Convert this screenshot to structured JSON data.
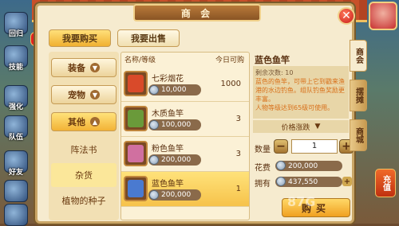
{
  "left_menu": [
    "回归",
    "技能",
    "强化",
    "队伍",
    "好友"
  ],
  "window": {
    "title": "商 会",
    "tabs": {
      "buy": "我要购买",
      "sell": "我要出售"
    }
  },
  "categories": {
    "equipment": "装备",
    "pet": "宠物",
    "other": "其他",
    "sub_items": [
      "阵法书",
      "杂货",
      "植物的种子"
    ]
  },
  "table": {
    "col_name": "名称/等级",
    "col_count": "今日可购",
    "rows": [
      {
        "name": "七彩烟花",
        "price": "10,000",
        "count": "1000",
        "color": "#d94a2a"
      },
      {
        "name": "木质鱼竿",
        "price": "100,000",
        "count": "3",
        "color": "#6a9a3a"
      },
      {
        "name": "粉色鱼竿",
        "price": "200,000",
        "count": "3",
        "color": "#d070a0"
      },
      {
        "name": "蓝色鱼竿",
        "price": "200,000",
        "count": "1",
        "color": "#4a7ad0"
      }
    ]
  },
  "detail": {
    "name": "蓝色鱼竿",
    "desc_line1": "剩余次数: 10",
    "desc_line2": "蓝色的鱼竿，可带上它到戳来渔港的水边钓鱼。组队钓鱼奖励更丰富。",
    "desc_line3": "人物等级达到65级可使用。",
    "price_trend": "价格涨跌",
    "qty_label": "数量",
    "qty_value": "1",
    "cost_label": "花费",
    "cost_value": "200,000",
    "own_label": "拥有",
    "own_value": "437,550",
    "buy_label": "购买"
  },
  "side_tabs": [
    "商会",
    "摆摊",
    "商城"
  ],
  "recharge_label": "充值",
  "watermark": "87G"
}
